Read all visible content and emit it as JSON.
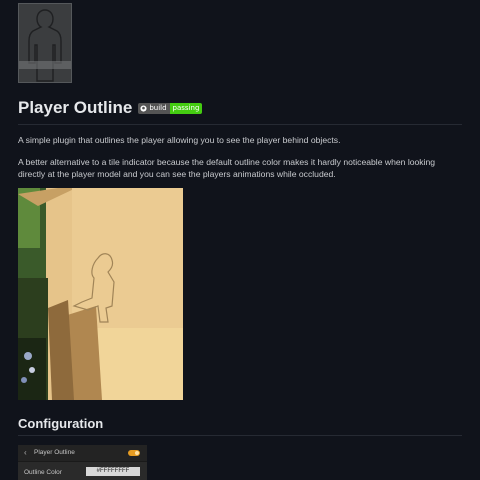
{
  "page": {
    "title": "Player Outline",
    "badge": {
      "label": "build",
      "status": "passing",
      "status_color": "#44cc11"
    },
    "intro": "A simple plugin that outlines the player allowing you to see the player behind objects.",
    "body": "A better alternative to a tile indicator because the default outline color makes it hardly noticeable when looking directly at the player model and you can see the players animations while occluded.",
    "config_heading": "Configuration"
  },
  "config_panel": {
    "back_icon": "chevron-left-icon",
    "title": "Player Outline",
    "toggle_on": true,
    "row_label": "Outline Color",
    "row_value": "#FFFFFFFF"
  },
  "colors": {
    "background": "#10131b",
    "accent_toggle": "#e79c22"
  }
}
